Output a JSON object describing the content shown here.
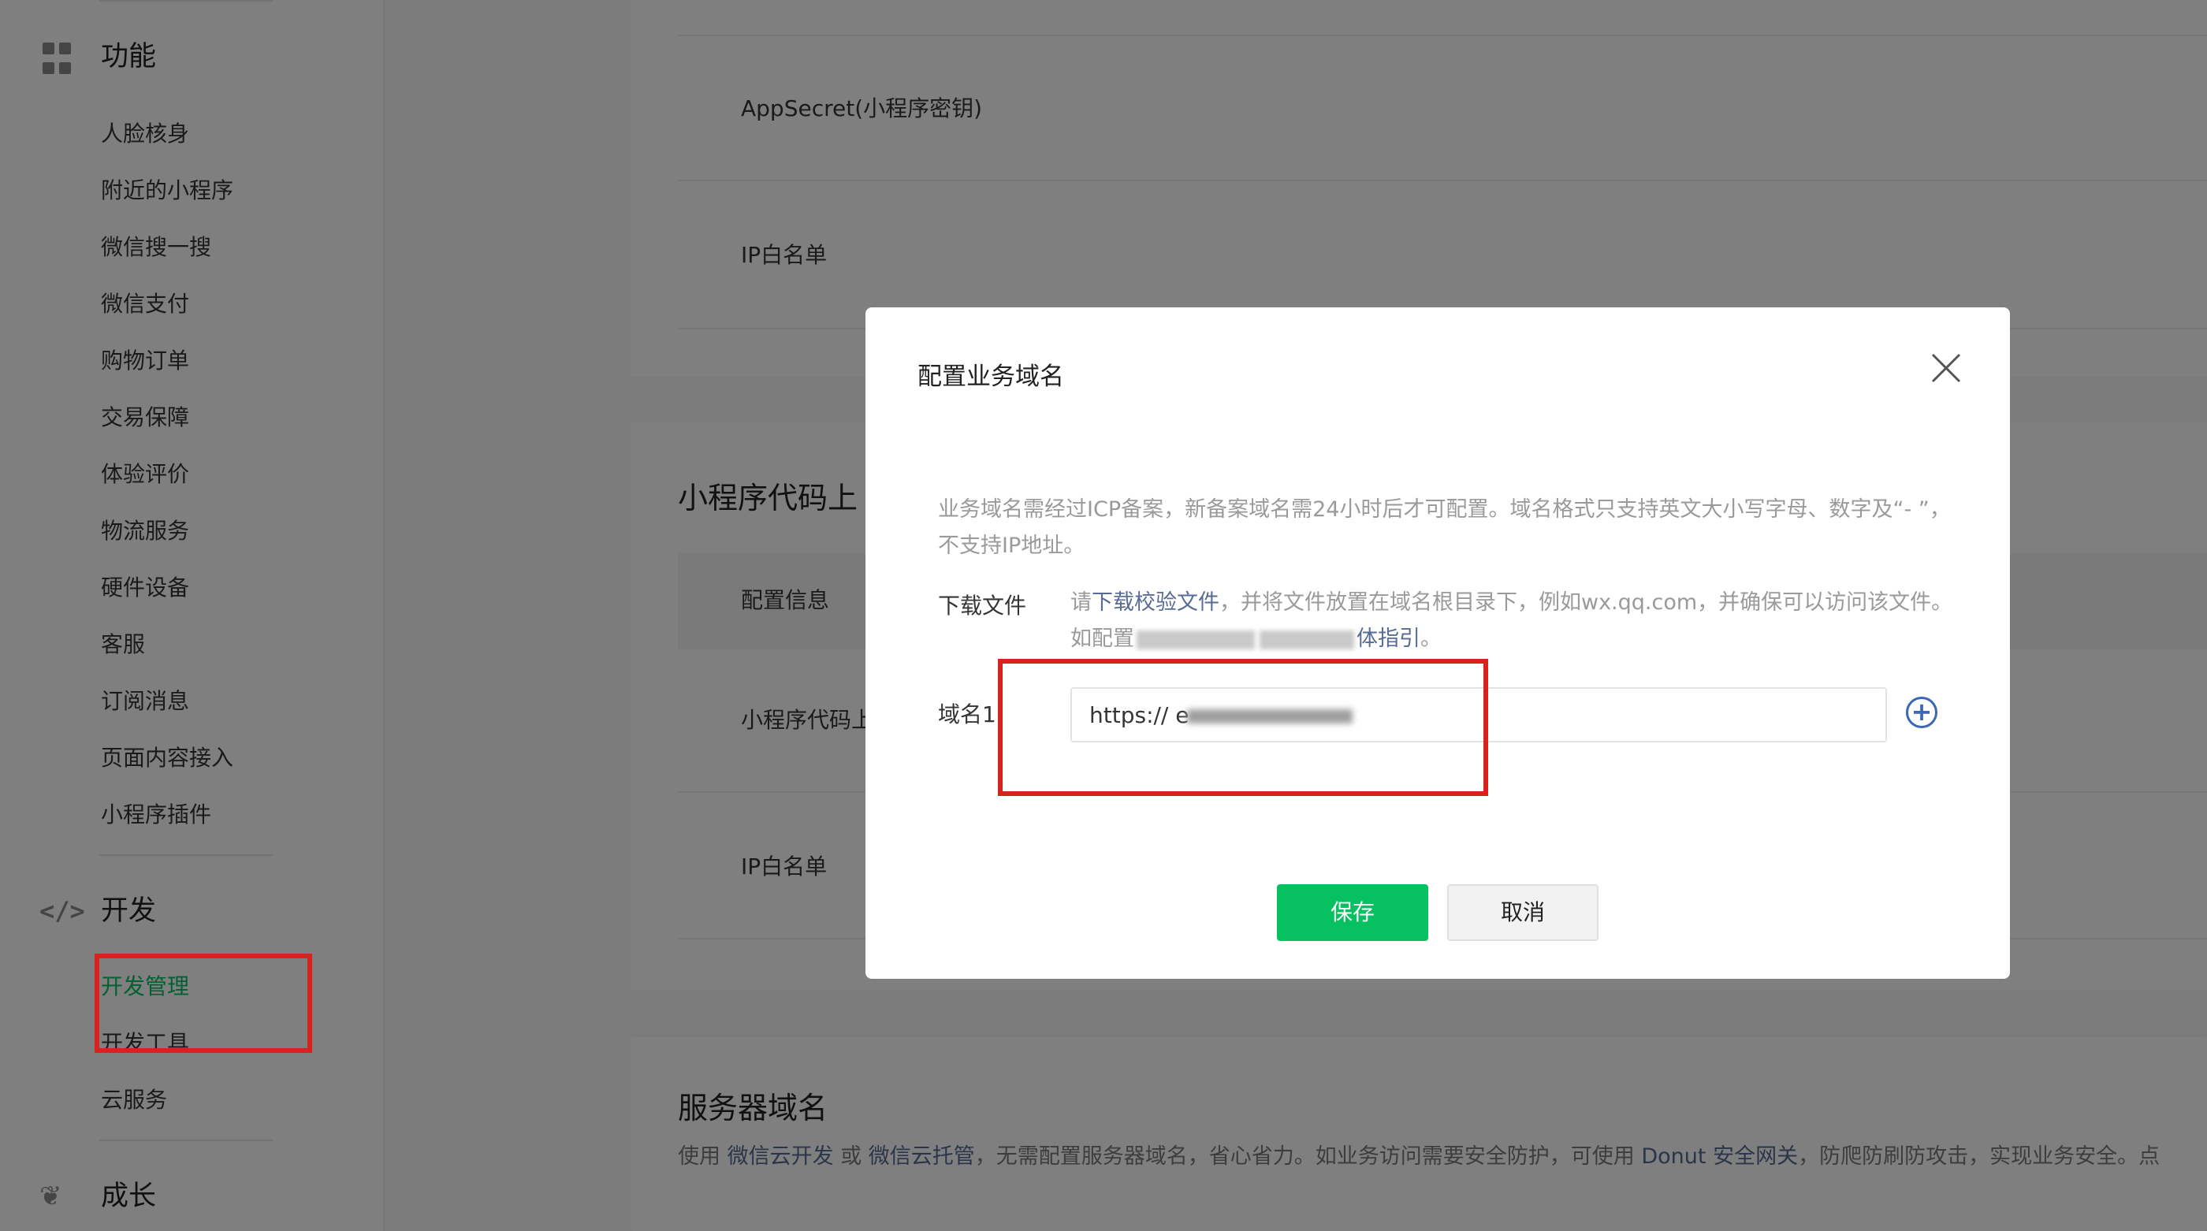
{
  "sidebar": {
    "groups": [
      {
        "label": "功能",
        "icon": "grid-icon"
      },
      {
        "label": "开发",
        "icon": "code-icon"
      },
      {
        "label": "成长",
        "icon": "leaf-icon"
      }
    ],
    "function_items": [
      "人脸核身",
      "附近的小程序",
      "微信搜一搜",
      "微信支付",
      "购物订单",
      "交易保障",
      "体验评价",
      "物流服务",
      "硬件设备",
      "客服",
      "订阅消息",
      "页面内容接入",
      "小程序插件"
    ],
    "dev_items": [
      "开发管理",
      "开发工具",
      "云服务"
    ],
    "active_item": "开发管理",
    "active_color": "#07c160"
  },
  "main": {
    "appsecret_label": "AppSecret(小程序密钥)",
    "ip_whitelist_label": "IP白名单",
    "code_upload_title": "小程序代码上",
    "config_info_header": "配置信息",
    "code_upload_row": "小程序代码上",
    "ip_whitelist_label_2": "IP白名单",
    "server_domain_title": "服务器域名",
    "server_desc": {
      "prefix": "使用",
      "link1": "微信云开发",
      "or": "或",
      "link2": "微信云托管",
      "middle": "，无需配置服务器域名，省心省力。如业务访问需要安全防护，可使用",
      "link3": "Donut 安全网关",
      "suffix": "，防爬防刷防攻击，实现业务安全。点"
    }
  },
  "dialog": {
    "title": "配置业务域名",
    "notice": "业务域名需经过ICP备案，新备案域名需24小时后才可配置。域名格式只支持英文大小写字母、数字及“- ”，不支持IP地址。",
    "download_label": "下载文件",
    "download_desc": {
      "prefix": "请",
      "link": "下载校验文件",
      "middle": "，并将文件放置在域名根目录下，例如wx.qq.com，并确保可以访问该文件。如配置",
      "link2": "体指引",
      "end": "。"
    },
    "domain_label": "域名1",
    "domain_value": "https:// e",
    "save_label": "保存",
    "cancel_label": "取消"
  },
  "colors": {
    "accent": "#07c160",
    "link": "#576b95",
    "annotation": "#d9211e"
  }
}
